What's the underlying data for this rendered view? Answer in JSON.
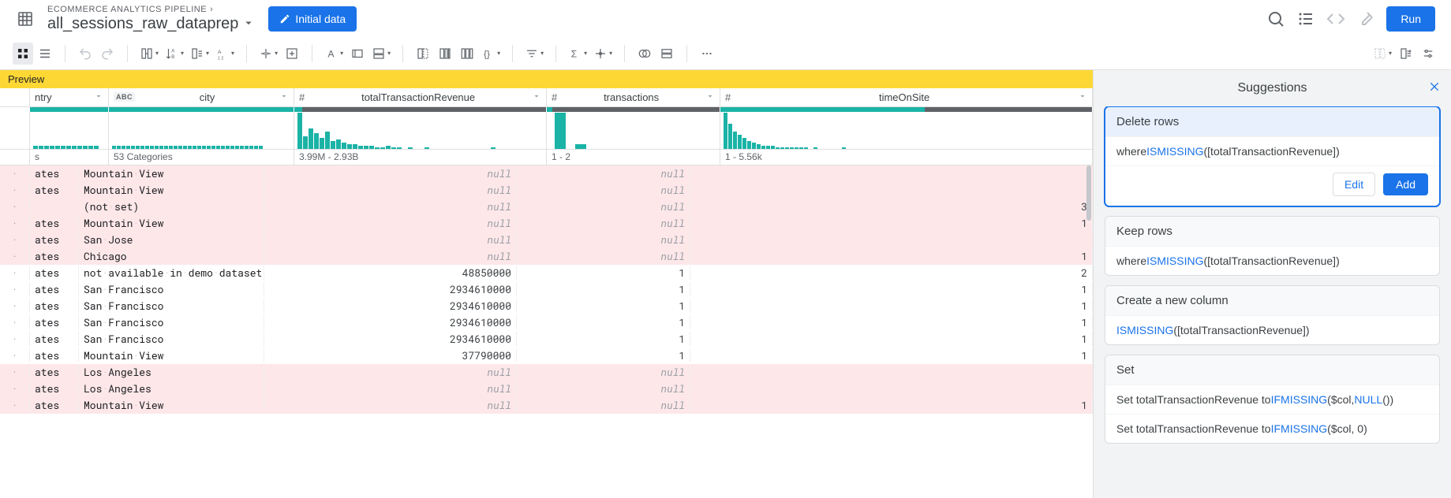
{
  "header": {
    "breadcrumb": "ECOMMERCE ANALYTICS PIPELINE",
    "flow_title": "all_sessions_raw_dataprep",
    "initial_data_btn": "Initial data",
    "run_btn": "Run"
  },
  "preview_label": "Preview",
  "columns": {
    "country": {
      "name": "ntry",
      "summary": "s"
    },
    "city": {
      "name": "city",
      "type_badge": "ABC",
      "summary": "53 Categories"
    },
    "rev": {
      "name": "totalTransactionRevenue",
      "summary": "3.99M - 2.93B"
    },
    "trans": {
      "name": "transactions",
      "summary": "1 - 2"
    },
    "time": {
      "name": "timeOnSite",
      "summary": "1 - 5.56k"
    }
  },
  "null_label": "null",
  "rows": [
    {
      "country": "ates",
      "city": "Mountain View",
      "rev": null,
      "trans": null,
      "time": "",
      "deleted": true
    },
    {
      "country": "ates",
      "city": "Mountain View",
      "rev": null,
      "trans": null,
      "time": "",
      "deleted": true
    },
    {
      "country": "",
      "city": "(not set)",
      "rev": null,
      "trans": null,
      "time": "3",
      "deleted": true
    },
    {
      "country": "ates",
      "city": "Mountain View",
      "rev": null,
      "trans": null,
      "time": "1",
      "deleted": true
    },
    {
      "country": "ates",
      "city": "San Jose",
      "rev": null,
      "trans": null,
      "time": "",
      "deleted": true
    },
    {
      "country": "ates",
      "city": "Chicago",
      "rev": null,
      "trans": null,
      "time": "1",
      "deleted": true
    },
    {
      "country": "ates",
      "city": "not available in demo dataset",
      "rev": "48850000",
      "trans": "1",
      "time": "2",
      "deleted": false
    },
    {
      "country": "ates",
      "city": "San Francisco",
      "rev": "2934610000",
      "trans": "1",
      "time": "1",
      "deleted": false
    },
    {
      "country": "ates",
      "city": "San Francisco",
      "rev": "2934610000",
      "trans": "1",
      "time": "1",
      "deleted": false
    },
    {
      "country": "ates",
      "city": "San Francisco",
      "rev": "2934610000",
      "trans": "1",
      "time": "1",
      "deleted": false
    },
    {
      "country": "ates",
      "city": "San Francisco",
      "rev": "2934610000",
      "trans": "1",
      "time": "1",
      "deleted": false
    },
    {
      "country": "ates",
      "city": "Mountain View",
      "rev": "37790000",
      "trans": "1",
      "time": "1",
      "deleted": false
    },
    {
      "country": "ates",
      "city": "Los Angeles",
      "rev": null,
      "trans": null,
      "time": "",
      "deleted": true
    },
    {
      "country": "ates",
      "city": "Los Angeles",
      "rev": null,
      "trans": null,
      "time": "",
      "deleted": true
    },
    {
      "country": "ates",
      "city": "Mountain View",
      "rev": null,
      "trans": null,
      "time": "1",
      "deleted": true
    }
  ],
  "panel": {
    "title": "Suggestions",
    "edit_btn": "Edit",
    "add_btn": "Add",
    "cards": {
      "delete": {
        "title": "Delete rows",
        "prefix": "where ",
        "fn": "ISMISSING",
        "arg": "([totalTransactionRevenue])"
      },
      "keep": {
        "title": "Keep rows",
        "prefix": "where ",
        "fn": "ISMISSING",
        "arg": "([totalTransactionRevenue])"
      },
      "newcol": {
        "title": "Create a new column",
        "fn": "ISMISSING",
        "arg": "([totalTransactionRevenue])"
      },
      "set": {
        "title": "Set",
        "row1_prefix": "Set totalTransactionRevenue to ",
        "row1_fn": "IFMISSING",
        "row1_mid": "($col, ",
        "row1_fn2": "NULL",
        "row1_suffix": "())",
        "row2_prefix": "Set totalTransactionRevenue to ",
        "row2_fn": "IFMISSING",
        "row2_suffix": "($col, 0)"
      }
    }
  },
  "histograms": {
    "country": [
      4,
      4,
      4,
      4,
      4,
      4,
      4,
      4,
      4,
      4,
      4,
      4
    ],
    "city": [
      4,
      4,
      4,
      4,
      4,
      4,
      4,
      4,
      4,
      4,
      4,
      4,
      4,
      4,
      4,
      4,
      4,
      4,
      4,
      4,
      4,
      4,
      4,
      4,
      4,
      4,
      4,
      4,
      4,
      4,
      4,
      4
    ],
    "rev": [
      46,
      16,
      26,
      20,
      14,
      22,
      10,
      12,
      8,
      6,
      6,
      4,
      4,
      4,
      2,
      2,
      4,
      2,
      2,
      0,
      2,
      0,
      0,
      2,
      0,
      0,
      0,
      0,
      0,
      0,
      0,
      0,
      0,
      0,
      0,
      2
    ],
    "trans": [
      46,
      6
    ],
    "time": [
      46,
      32,
      22,
      18,
      14,
      10,
      8,
      6,
      4,
      4,
      4,
      2,
      2,
      2,
      2,
      2,
      2,
      2,
      0,
      2,
      0,
      0,
      0,
      0,
      0,
      2
    ]
  },
  "quality": {
    "country": {
      "valid": 100
    },
    "city": {
      "valid": 100
    },
    "rev": {
      "valid": 3
    },
    "trans": {
      "valid": 3
    },
    "time": {
      "valid": 55
    }
  }
}
